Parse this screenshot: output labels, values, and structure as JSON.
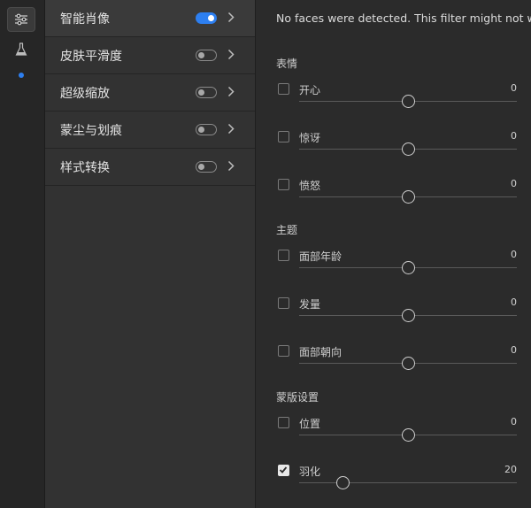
{
  "rail": {
    "icons": [
      "sliders-icon",
      "flask-icon",
      "dot-indicator"
    ]
  },
  "filters": [
    {
      "label": "智能肖像",
      "on": true,
      "selected": true
    },
    {
      "label": "皮肤平滑度",
      "on": false,
      "selected": false
    },
    {
      "label": "超级缩放",
      "on": false,
      "selected": false
    },
    {
      "label": "蒙尘与划痕",
      "on": false,
      "selected": false
    },
    {
      "label": "样式转换",
      "on": false,
      "selected": false
    }
  ],
  "settings": {
    "notice": "No faces were detected. This filter might not work pro",
    "sections": [
      {
        "title": "表情",
        "rows": [
          {
            "label": "开心",
            "value": 0,
            "fraction": 0.5,
            "checked": false
          },
          {
            "label": "惊讶",
            "value": 0,
            "fraction": 0.5,
            "checked": false
          },
          {
            "label": "愤怒",
            "value": 0,
            "fraction": 0.5,
            "checked": false
          }
        ]
      },
      {
        "title": "主题",
        "rows": [
          {
            "label": "面部年龄",
            "value": 0,
            "fraction": 0.5,
            "checked": false
          },
          {
            "label": "发量",
            "value": 0,
            "fraction": 0.5,
            "checked": false
          },
          {
            "label": "面部朝向",
            "value": 0,
            "fraction": 0.5,
            "checked": false
          }
        ]
      },
      {
        "title": "蒙版设置",
        "rows": [
          {
            "label": "位置",
            "value": 0,
            "fraction": 0.5,
            "checked": false
          },
          {
            "label": "羽化",
            "value": 20,
            "fraction": 0.2,
            "checked": true
          }
        ]
      }
    ]
  },
  "colors": {
    "accent": "#2d7ff0",
    "background": "#2b2b2b",
    "panel": "#323232"
  }
}
